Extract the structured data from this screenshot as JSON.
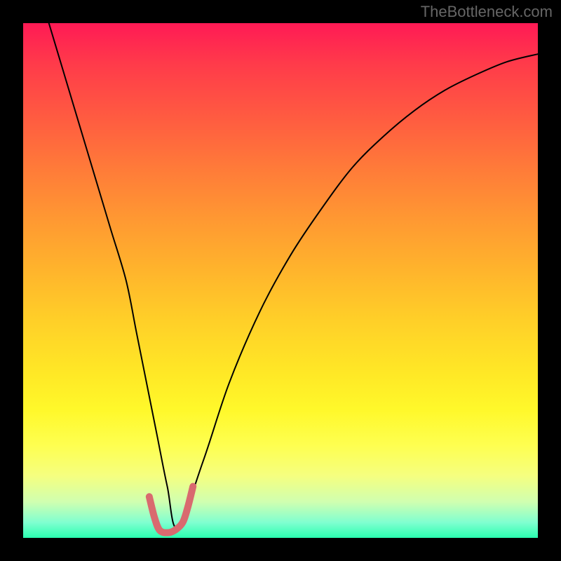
{
  "watermark": "TheBottleneck.com",
  "chart_data": {
    "type": "line",
    "title": "",
    "xlabel": "",
    "ylabel": "",
    "xlim": [
      0,
      100
    ],
    "ylim": [
      0,
      100
    ],
    "background_gradient": {
      "top": "#ff1a55",
      "mid": "#ffd028",
      "bottom": "#2affb0"
    },
    "series": [
      {
        "name": "black-curve",
        "color": "#000000",
        "width": 2,
        "x": [
          5,
          8,
          11,
          14,
          17,
          20,
          22,
          24,
          26,
          28,
          30,
          35,
          40,
          46,
          52,
          58,
          64,
          70,
          76,
          82,
          88,
          94,
          100
        ],
        "y": [
          100,
          90,
          80,
          70,
          60,
          50,
          40,
          30,
          20,
          10,
          2,
          15,
          30,
          44,
          55,
          64,
          72,
          78,
          83,
          87,
          90,
          92.5,
          94
        ]
      },
      {
        "name": "pink-valley",
        "color": "#d96a6f",
        "width": 10,
        "x": [
          24.5,
          25.5,
          26.5,
          28,
          29.5,
          31,
          32,
          33
        ],
        "y": [
          8,
          4,
          1.5,
          1,
          1.5,
          3,
          6,
          10
        ]
      }
    ],
    "notes": "Figure has no visible axis ticks, labels, or units; x/y normalized 0-100. Valley minimum near x≈28."
  }
}
